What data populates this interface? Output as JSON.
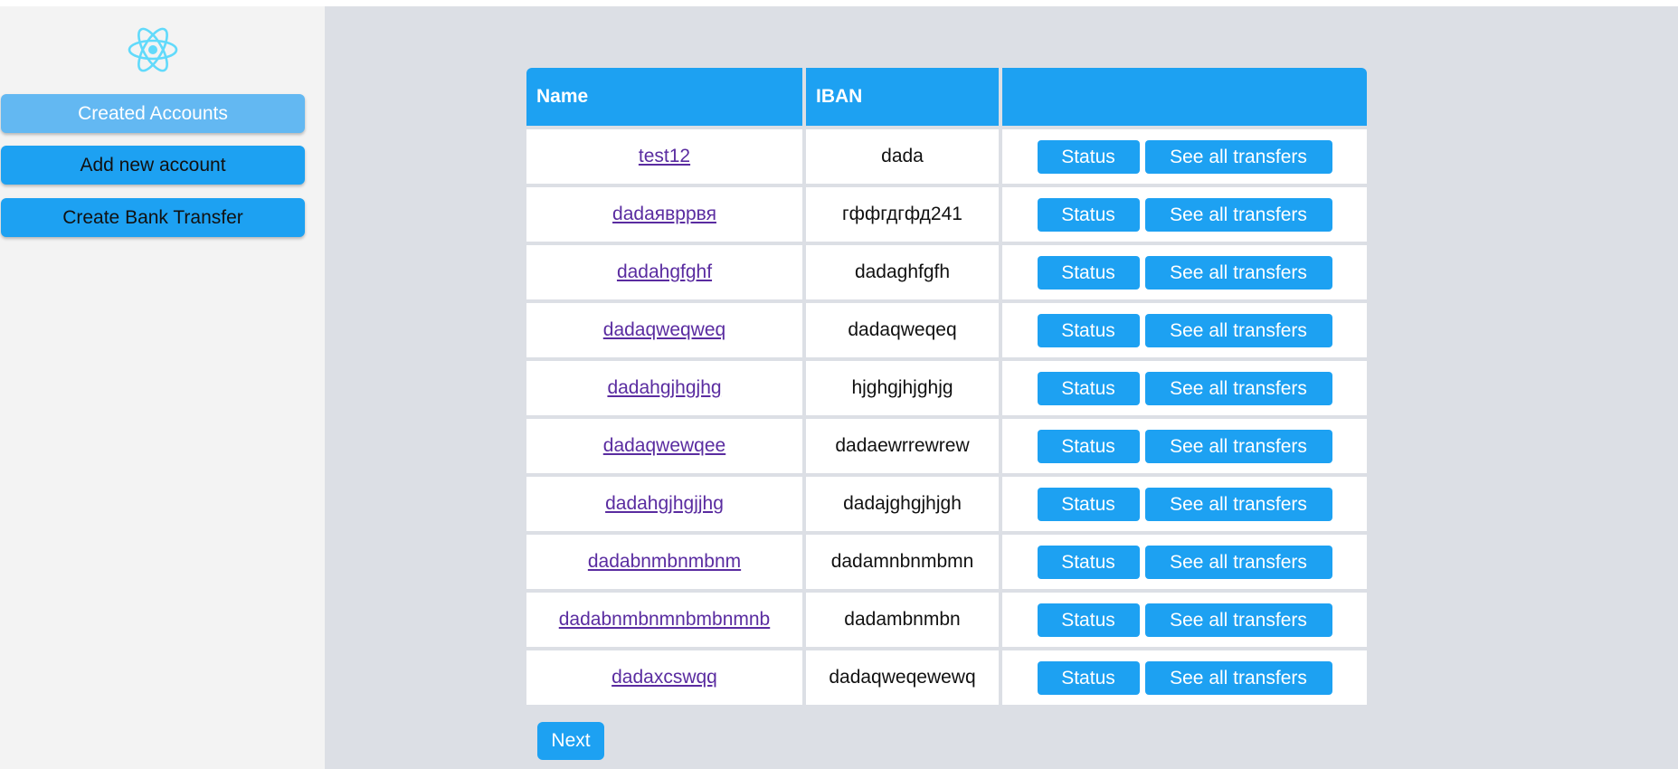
{
  "sidebar": {
    "logo_icon": "react-atom-icon",
    "items": [
      {
        "label": "Created Accounts",
        "active": true
      },
      {
        "label": "Add new account",
        "active": false
      },
      {
        "label": "Create Bank Transfer",
        "active": false
      }
    ]
  },
  "table": {
    "headers": {
      "name": "Name",
      "iban": "IBAN",
      "actions": ""
    },
    "rows": [
      {
        "name": "test12",
        "iban": "dada",
        "status": "Status",
        "transfers": "See all transfers"
      },
      {
        "name": "dadaяврpвя",
        "iban": "гффгдгфд241",
        "status": "Status",
        "transfers": "See all transfers"
      },
      {
        "name": "dadahgfghf",
        "iban": "dadaghfgfh",
        "status": "Status",
        "transfers": "See all transfers"
      },
      {
        "name": "dadaqweqweq",
        "iban": "dadaqweqeq",
        "status": "Status",
        "transfers": "See all transfers"
      },
      {
        "name": "dadahgjhgjhg",
        "iban": "hjghgjhjghjg",
        "status": "Status",
        "transfers": "See all transfers"
      },
      {
        "name": "dadaqwewqee",
        "iban": "dadaewrrewrew",
        "status": "Status",
        "transfers": "See all transfers"
      },
      {
        "name": "dadahgjhgjjhg",
        "iban": "dadajghgjhjgh",
        "status": "Status",
        "transfers": "See all transfers"
      },
      {
        "name": "dadabnmbnmbnm",
        "iban": "dadamnbnmbmn",
        "status": "Status",
        "transfers": "See all transfers"
      },
      {
        "name": "dadabnmbnmnbmbnmnb",
        "iban": "dadambnmbn",
        "status": "Status",
        "transfers": "See all transfers"
      },
      {
        "name": "dadaxcswqq",
        "iban": "dadaqweqewewq",
        "status": "Status",
        "transfers": "See all transfers"
      }
    ]
  },
  "pagination": {
    "next_label": "Next"
  },
  "colors": {
    "accent": "#1da1f2",
    "accent_active": "#63b8f2",
    "link": "#5a2ca0",
    "main_bg": "#dcdfe5",
    "sidebar_bg": "#f3f3f3"
  }
}
